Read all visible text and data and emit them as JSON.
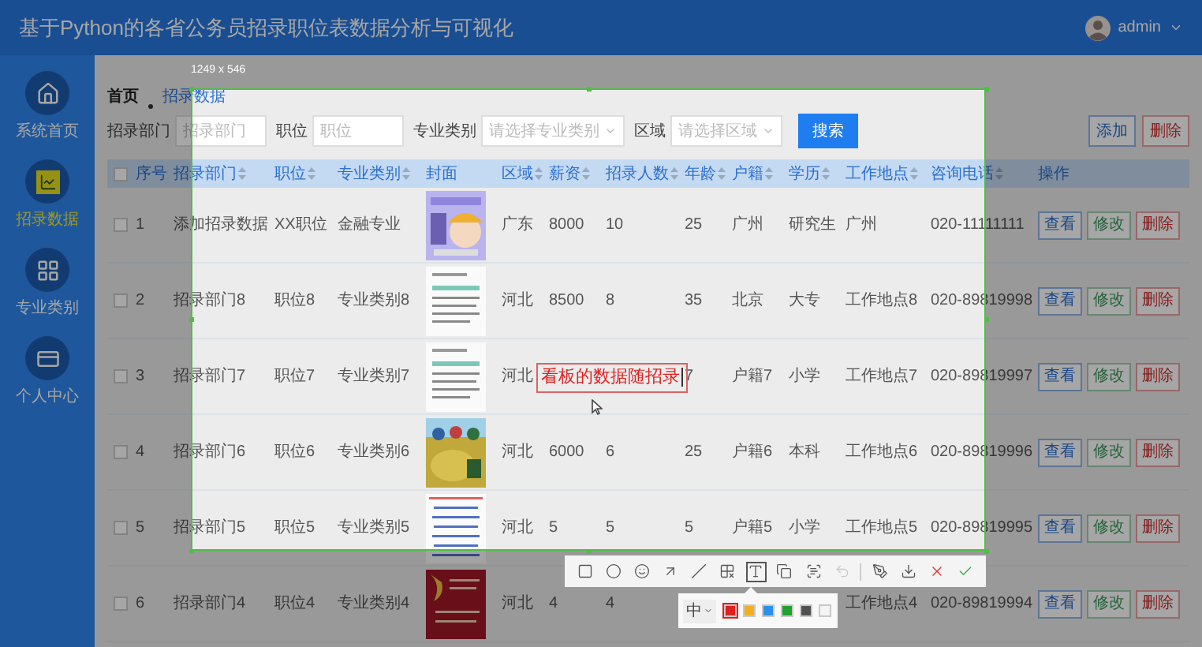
{
  "header": {
    "title": "基于Python的各省公务员招录职位表数据分析与可视化",
    "user": "admin"
  },
  "sidebar": {
    "items": [
      {
        "label": "系统首页",
        "selected": false
      },
      {
        "label": "招录数据",
        "selected": true
      },
      {
        "label": "专业类别",
        "selected": false
      },
      {
        "label": "个人中心",
        "selected": false
      }
    ]
  },
  "breadcrumb": [
    {
      "label": "首页",
      "link": false
    },
    {
      "label": "招录数据",
      "link": true
    }
  ],
  "filters": [
    {
      "label": "招录部门",
      "kind": "input",
      "placeholder": "招录部门"
    },
    {
      "label": "职位",
      "kind": "input",
      "placeholder": "职位"
    },
    {
      "label": "专业类别",
      "kind": "select",
      "placeholder": "请选择专业类别"
    },
    {
      "label": "区域",
      "kind": "select",
      "placeholder": "请选择区域"
    }
  ],
  "search_button": "搜索",
  "toolbar_buttons": [
    {
      "label": "添加",
      "kind": "add"
    },
    {
      "label": "删除",
      "kind": "delete"
    }
  ],
  "table": {
    "header_checked": false,
    "columns": [
      {
        "label": "序号",
        "sortable": false
      },
      {
        "label": "招录部门",
        "sortable": true
      },
      {
        "label": "职位",
        "sortable": true
      },
      {
        "label": "专业类别",
        "sortable": true
      },
      {
        "label": "封面",
        "sortable": false
      },
      {
        "label": "区域",
        "sortable": true
      },
      {
        "label": "薪资",
        "sortable": true
      },
      {
        "label": "招录人数",
        "sortable": true
      },
      {
        "label": "年龄",
        "sortable": true
      },
      {
        "label": "户籍",
        "sortable": true
      },
      {
        "label": "学历",
        "sortable": true
      },
      {
        "label": "工作地点",
        "sortable": true
      },
      {
        "label": "咨询电话",
        "sortable": true
      },
      {
        "label": "操作",
        "sortable": false
      }
    ],
    "rows": [
      {
        "checked": false,
        "cells": [
          "1",
          "添加招录数据",
          "XX职位",
          "金融专业",
          {
            "kind": "picture"
          },
          "广东",
          "8000",
          "10",
          "25",
          "广州",
          "研究生",
          "广州",
          "020-11111111"
        ],
        "actions": [
          {
            "label": "查看",
            "kind": "view"
          },
          {
            "label": "修改",
            "kind": "edit"
          },
          {
            "label": "删除",
            "kind": "delete"
          }
        ]
      },
      {
        "checked": false,
        "cells": [
          "2",
          "招录部门8",
          "职位8",
          "专业类别8",
          {
            "kind": "picture"
          },
          "河北",
          "8500",
          "8",
          "35",
          "北京",
          "大专",
          "工作地点8",
          "020-89819998"
        ],
        "actions": [
          {
            "label": "查看",
            "kind": "view"
          },
          {
            "label": "修改",
            "kind": "edit"
          },
          {
            "label": "删除",
            "kind": "delete"
          }
        ]
      },
      {
        "checked": false,
        "cells": [
          "3",
          "招录部门7",
          "职位7",
          "专业类别7",
          {
            "kind": "picture"
          },
          "河北",
          null,
          null,
          "7",
          "户籍7",
          "小学",
          "工作地点7",
          "020-89819997"
        ],
        "actions": [
          {
            "label": "查看",
            "kind": "view"
          },
          {
            "label": "修改",
            "kind": "edit"
          },
          {
            "label": "删除",
            "kind": "delete"
          }
        ]
      },
      {
        "checked": false,
        "cells": [
          "4",
          "招录部门6",
          "职位6",
          "专业类别6",
          {
            "kind": "picture"
          },
          "河北",
          "6000",
          "6",
          "25",
          "户籍6",
          "本科",
          "工作地点6",
          "020-89819996"
        ],
        "actions": [
          {
            "label": "查看",
            "kind": "view"
          },
          {
            "label": "修改",
            "kind": "edit"
          },
          {
            "label": "删除",
            "kind": "delete"
          }
        ]
      },
      {
        "checked": false,
        "cells": [
          "5",
          "招录部门5",
          "职位5",
          "专业类别5",
          {
            "kind": "picture"
          },
          "河北",
          "5",
          "5",
          "5",
          "户籍5",
          "小学",
          "工作地点5",
          "020-89819995"
        ],
        "actions": [
          {
            "label": "查看",
            "kind": "view"
          },
          {
            "label": "修改",
            "kind": "edit"
          },
          {
            "label": "删除",
            "kind": "delete"
          }
        ]
      },
      {
        "checked": false,
        "cells": [
          "6",
          "招录部门4",
          "职位4",
          "专业类别4",
          {
            "kind": "picture"
          },
          "河北",
          "4",
          "4",
          null,
          null,
          null,
          "工作地点4",
          "020-89819994"
        ],
        "actions": [
          {
            "label": "查看",
            "kind": "view"
          },
          {
            "label": "修改",
            "kind": "edit"
          },
          {
            "label": "删除",
            "kind": "delete"
          }
        ]
      }
    ]
  },
  "capture": {
    "size_label": "1249 x 546",
    "annotation": "看板的数据随招录",
    "tools": [
      {
        "selected": false,
        "disabled": false
      },
      {
        "selected": false,
        "disabled": false
      },
      {
        "selected": false,
        "disabled": false
      },
      {
        "selected": false,
        "disabled": false
      },
      {
        "selected": false,
        "disabled": false
      },
      {
        "selected": false,
        "disabled": false
      },
      {
        "selected": true,
        "disabled": false
      },
      {
        "selected": false,
        "disabled": false
      },
      {
        "selected": false,
        "disabled": false
      },
      {
        "selected": false,
        "disabled": true
      },
      {
        "selected": false,
        "disabled": false
      },
      {
        "selected": false,
        "disabled": false
      },
      {
        "selected": false,
        "disabled": false
      },
      {
        "selected": false,
        "disabled": false
      }
    ],
    "font_size": "中",
    "colors": [
      {
        "color": "#e02020",
        "selected": true
      },
      {
        "color": "#f0b020",
        "selected": false
      },
      {
        "color": "#2a90e8",
        "selected": false
      },
      {
        "color": "#22a030",
        "selected": false
      },
      {
        "color": "#505050",
        "selected": false
      },
      {
        "color": "#f4f4f4",
        "selected": false
      }
    ]
  }
}
